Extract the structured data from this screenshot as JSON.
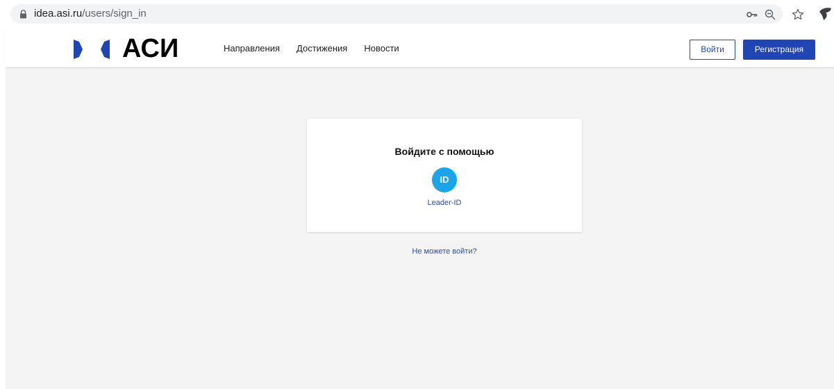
{
  "browser": {
    "url_host": "idea.asi.ru",
    "url_path": "/users/sign_in",
    "icons": [
      "lock-icon",
      "key-icon",
      "zoom-icon",
      "star-icon",
      "extension-icon"
    ]
  },
  "header": {
    "logo_text": "АСИ",
    "nav": [
      {
        "label": "Направления"
      },
      {
        "label": "Достижения"
      },
      {
        "label": "Новости"
      }
    ],
    "login_label": "Войти",
    "register_label": "Регистрация"
  },
  "login_card": {
    "title": "Войдите с помощью",
    "provider_icon_text": "ID",
    "provider_label": "Leader-ID"
  },
  "help_link": "Не можете войти?",
  "colors": {
    "brand_blue": "#2145b2",
    "leader_id_blue": "#1aa4ea",
    "page_bg": "#f4f4f4"
  }
}
